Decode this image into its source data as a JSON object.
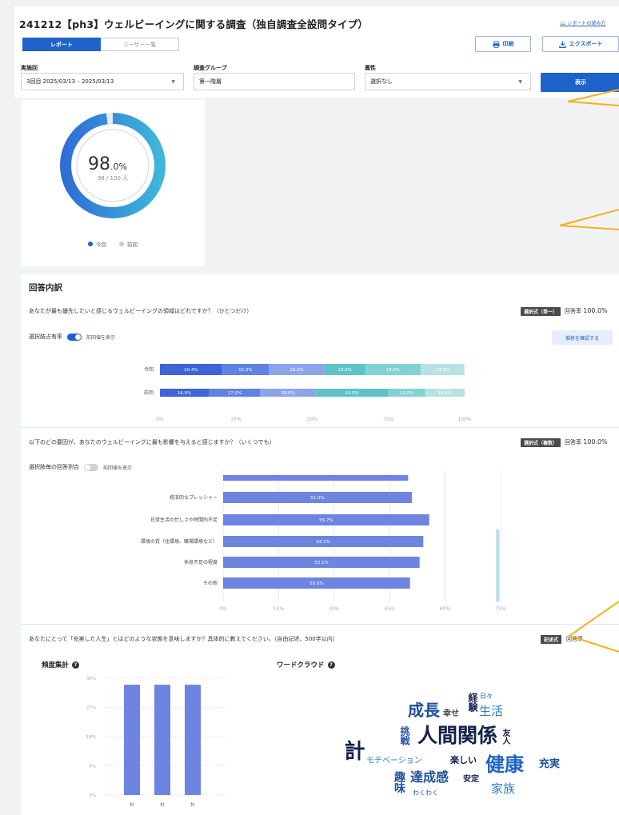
{
  "header": {
    "title": "241212【ph3】ウェルビーイングに関する調査（独自調査全設問タイプ）",
    "guide_link": "レポートの読み方",
    "tabs": [
      {
        "label": "レポート",
        "active": true
      },
      {
        "label": "ユーザー一覧",
        "active": false
      }
    ],
    "print_label": "印刷",
    "export_label": "エクスポート"
  },
  "filters": {
    "round": {
      "label": "実施回",
      "value": "3回目 2025/03/13 – 2025/03/13"
    },
    "group": {
      "label": "調査グループ",
      "value": "第一階層"
    },
    "attribute": {
      "label": "属性",
      "value": "選択なし"
    },
    "show_label": "表示"
  },
  "response_rate": {
    "percent_main": "98",
    "percent_unit": ".0%",
    "counts": "98 / 100 人",
    "fraction": 0.98,
    "legend": [
      {
        "label": "今回",
        "color": "#1e63c9"
      },
      {
        "label": "前回",
        "color": "#c9ccd1"
      }
    ]
  },
  "breakdown": {
    "section_title": "回答内訳",
    "q1": {
      "question": "あなたが最も優先したいと感じるウェルビーイングの領域はどれですか？（ひとつだけ）",
      "type_badge": "選択式（単一）",
      "rate_label": "回答率",
      "rate_value": "100.0%",
      "sub_label": "選択肢占有率",
      "toggle_label": "前回値を表示",
      "toggle_on": true,
      "detail_button": "推移を確認する"
    },
    "q2": {
      "question": "以下のどの要因が、あなたのウェルビーイングに最も影響を与えると感じますか？（いくつでも）",
      "type_badge": "選択式（複数）",
      "rate_label": "回答率",
      "rate_value": "100.0%",
      "sub_label": "選択肢毎の回答割合",
      "toggle_label": "前回値を表示",
      "toggle_on": false
    },
    "q3": {
      "question": "あなたにとって「充実した人生」とはどのような状態を意味しますか？具体的に教えてください。（自由記述、500字以内）",
      "type_badge": "記述式",
      "rate_label": "回答率",
      "freq_title": "頻度集計",
      "wc_title": "ワードクラウド",
      "word_cloud": [
        {
          "word": "成長",
          "color": "#1e4f9c"
        },
        {
          "word": "幸せ",
          "color": "#3a3a4a"
        },
        {
          "word": "経験",
          "color": "#12204a"
        },
        {
          "word": "日々",
          "color": "#1e4f9c"
        },
        {
          "word": "生活",
          "color": "#2a7fb8"
        },
        {
          "word": "挑戦",
          "color": "#1e4f9c"
        },
        {
          "word": "人間関係",
          "color": "#12204a"
        },
        {
          "word": "友人",
          "color": "#12204a"
        },
        {
          "word": "モチベーション",
          "color": "#2a7fb8"
        },
        {
          "word": "楽しい",
          "color": "#12204a"
        },
        {
          "word": "健康",
          "color": "#1e63c9"
        },
        {
          "word": "充実",
          "color": "#1e4f9c"
        },
        {
          "word": "達成感",
          "color": "#1e4f9c"
        },
        {
          "word": "安定",
          "color": "#12204a"
        },
        {
          "word": "趣味",
          "color": "#1e4f9c"
        },
        {
          "word": "わくわく",
          "color": "#1e4f9c"
        },
        {
          "word": "家族",
          "color": "#2a7fb8"
        },
        {
          "word": "計",
          "color": "#12204a"
        }
      ]
    }
  },
  "chart_data": [
    {
      "type": "bar",
      "orientation": "horizontal-stacked",
      "categories": [
        "今回",
        "前回"
      ],
      "series": [
        {
          "values": [
            20.4,
            16.0
          ],
          "labels": [
            "20.4%",
            "16.0%"
          ],
          "color": "#3f63d9"
        },
        {
          "values": [
            15.3,
            17.0
          ],
          "labels": [
            "15.3%",
            "17.0%"
          ],
          "color": "#6182e4"
        },
        {
          "values": [
            18.3,
            18.0
          ],
          "labels": [
            "18.3%",
            "18.0%"
          ],
          "color": "#8ea4ea"
        },
        {
          "values": [
            13.3,
            24.0
          ],
          "labels": [
            "13.3%",
            "24.0%"
          ],
          "color": "#5dc3c8"
        },
        {
          "values": [
            18.3,
            12.0
          ],
          "labels": [
            "18.3%",
            "12.0%"
          ],
          "color": "#82d1d4"
        },
        {
          "values": [
            14.3,
            13.0
          ],
          "labels": [
            "14.3%",
            "13.0%"
          ],
          "color": "#b6e2e3"
        }
      ],
      "xlim": [
        0,
        100
      ],
      "xticks": [
        "0%",
        "25%",
        "50%",
        "75%",
        "100%"
      ]
    },
    {
      "type": "bar",
      "orientation": "horizontal",
      "categories": [
        "",
        "経済的なプレッシャー",
        "日常生活の忙しさや時間的不足",
        "環境の質（住環境、職場環境など）",
        "休息不足の程度",
        "その他"
      ],
      "values": [
        50.0,
        51.0,
        55.7,
        54.1,
        53.1,
        50.5
      ],
      "labels": [
        "",
        "51.0%",
        "55.7%",
        "54.1%",
        "53.1%",
        "50.5%"
      ],
      "xlim": [
        0,
        75
      ],
      "xticks": [
        "0%",
        "15%",
        "30%",
        "45%",
        "60%",
        "75%"
      ],
      "bar_color": "#6d85e0",
      "extra_bar_value": 74
    },
    {
      "type": "bar",
      "categories": [
        "計",
        "計",
        "計"
      ],
      "values": [
        34,
        34,
        34
      ],
      "ylim": [
        0,
        36
      ],
      "yticks": [
        "0%",
        "9%",
        "18%",
        "27%",
        "36%"
      ],
      "xticks": [
        "計",
        "計",
        "計"
      ],
      "bar_color": "#6d85e0"
    }
  ]
}
